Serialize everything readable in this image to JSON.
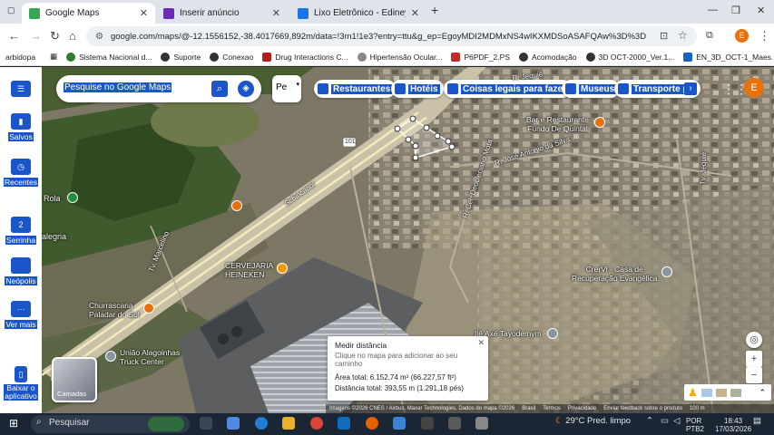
{
  "browser": {
    "tabs": [
      {
        "title": "Google Maps",
        "active": true
      },
      {
        "title": "Inserir anúncio",
        "active": false
      },
      {
        "title": "Lixo Eletrônico - Ediney vila - O",
        "active": false
      }
    ],
    "url": "google.com/maps/@-12.1556152,-38.4017669,892m/data=!3m1!1e3?entry=ttu&g_ep=EgoyMDI2MDMxNS4wIKXMDSoASAFQAw%3D%3D",
    "profile_initial": "E"
  },
  "bookmarks": [
    "arbidopa",
    "Sistema Nacional d...",
    "Suporte",
    "Conexao",
    "Drug Interactions C...",
    "Hipertensão Ocular...",
    "P6PDF_2.PS",
    "Acomodação",
    "3D OCT-2000_Ver.1...",
    "EN_3D_OCT-1_Maes..."
  ],
  "sidebar": [
    {
      "label": "Salvos",
      "icon": "bookmark-icon"
    },
    {
      "label": "Recentes",
      "icon": "history-icon"
    },
    {
      "label": "Serrinha",
      "icon": "recent-place-icon",
      "badge": "2"
    },
    {
      "label": "Neópolis",
      "icon": "recent-place-icon"
    },
    {
      "label": "Ver mais",
      "icon": "more-icon"
    },
    {
      "label": "Baixar o aplicativo",
      "icon": "phone-icon"
    }
  ],
  "search": {
    "placeholder": "Pesquise no Google Maps"
  },
  "pe_button": "Pe",
  "chips": [
    "Restaurantes",
    "Hotéis",
    "Coisas legais para fazer",
    "Museus",
    "Transporte p"
  ],
  "map_labels": {
    "bar": "Bar e Restaurante\nFundo De Quintal",
    "street1": "R. José Antonio da Silva",
    "street2": "R. Cel. Deocleciano Mota",
    "street3": "Tv. Jequié",
    "street4": "Schincariol",
    "road": "101",
    "cervejaria": "CERVEJARIA\nHEINEKEN",
    "crervi": "CrerVi - Casa de\nRecuperação Evangélica",
    "churrascaria": "Churrascaria\nPaladar do Sul",
    "uniao": "União Alagoinhas\nTruck Center",
    "ile": "Ilê Axé Tayodemym",
    "rola": "Rola",
    "alegria": "alegria",
    "tv_marcelino": "Tv. Marcelino",
    "top_street": "R. Jequié"
  },
  "measure_panel": {
    "title": "Medir distância",
    "subtitle": "Clique no mapa para adicionar ao seu caminho",
    "area": "Área total: 6.152,74 m² (66.227,57 ft²)",
    "distance": "Distância total: 393,55 m (1.291,18 pés)"
  },
  "layers_label": "Camadas",
  "footer": [
    "Imagens ©2026 CNES / Airbus, Maxar Technologies, Dados do mapa ©2026",
    "Brasil",
    "Termos",
    "Privacidade",
    "Enviar feedback sobre o produto",
    "100 m"
  ],
  "taskbar": {
    "search": "Pesquisar",
    "weather": "29°C  Pred. limpo",
    "lang1": "POR",
    "lang2": "PTB2",
    "time": "18:43",
    "date": "17/03/2026"
  }
}
